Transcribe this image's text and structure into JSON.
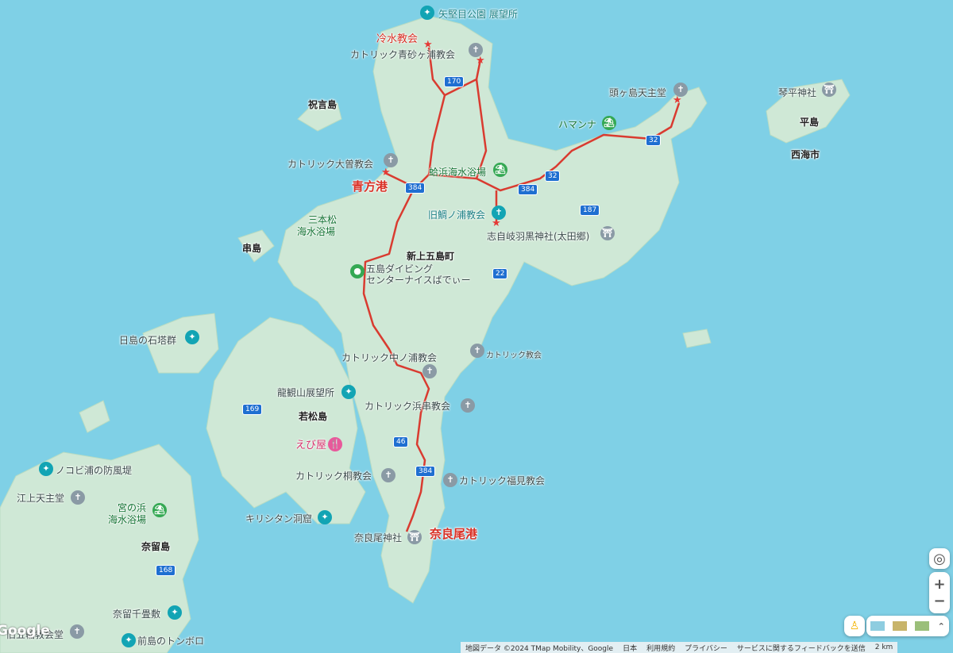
{
  "labels": {
    "yakatame_park": "矢堅目公園 展望所",
    "reisui_church": "冷水教会",
    "aosagaura_church": "カトリック青砂ヶ浦教会",
    "hokotojima": "祝言島",
    "kashirajima_church": "頭ヶ島天主堂",
    "kotohira": "琴平神社",
    "hirashima": "平島",
    "saikai": "西海市",
    "hamanna": "ハマンナ",
    "oso_church": "カトリック大曽教会",
    "hamaura_beach": "蛤浜海水浴場",
    "aokata_port": "青方港",
    "sanbonmatsu_l1": "三本松",
    "sanbonmatsu_l2": "海水浴場",
    "taiura_church": "旧鯛ノ浦教会",
    "shijiki": "志自岐羽黒神社(太田郷)",
    "kushijima": "串島",
    "town": "新上五島町",
    "diving_l1": "五島ダイビング",
    "diving_l2": "センターナイスばでぃー",
    "hinoshima": "日島の石塔群",
    "nakanoura_church": "カトリック中ノ浦教会",
    "catholic_church": "カトリック教会",
    "ryukanzan": "龍観山展望所",
    "wakamatsu": "若松島",
    "hamaguri_church": "カトリック浜串教会",
    "ebiya": "えび屋",
    "kiri_church": "カトリック桐教会",
    "fukumi_church": "カトリック福見教会",
    "nokobi": "ノコビ浦の防風堤",
    "egami": "江上天主堂",
    "miyanohama_l1": "宮の浜",
    "miyanohama_l2": "海水浴場",
    "kirishitan_cave": "キリシタン洞窟",
    "narao_shrine": "奈良尾神社",
    "narao_port": "奈良尾港",
    "naru": "奈留島",
    "naru_senjojiki": "奈留千畳敷",
    "kaminowa": "旧五輪教会堂",
    "maeshima": "前島のトンボロ"
  },
  "roads": {
    "r170": "170",
    "r384a": "384",
    "r384b": "384",
    "r32a": "32",
    "r32b": "32",
    "r187": "187",
    "r22": "22",
    "r169": "169",
    "r46": "46",
    "r384c": "384",
    "r168": "168"
  },
  "footer": {
    "mapdata": "地図データ ©2024 TMap Mobility、Google",
    "japan": "日本",
    "terms": "利用規約",
    "privacy": "プライバシー",
    "feedback": "サービスに関するフィードバックを送信",
    "scale": "2 km"
  },
  "google_logo": "Google",
  "colors": {
    "water": "#7fd0e6",
    "land": "#cfe8d6",
    "route": "#d93b30"
  }
}
